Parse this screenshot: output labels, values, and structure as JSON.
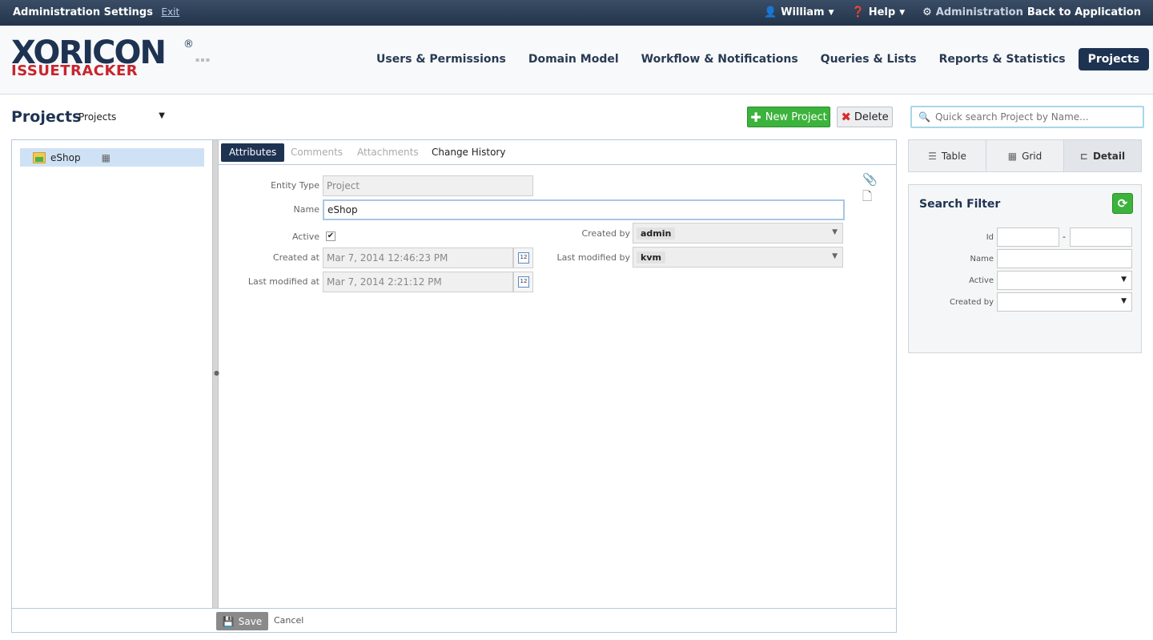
{
  "topbar": {
    "title": "Administration Settings",
    "exit": "Exit",
    "user": "William",
    "help": "Help",
    "admin": "Administration",
    "back": "Back to Application"
  },
  "logo": {
    "line1": "XORICON",
    "line2": "ISSUETRACKER",
    "reg": "®"
  },
  "nav": [
    {
      "label": "Users & Permissions"
    },
    {
      "label": "Domain Model"
    },
    {
      "label": "Workflow & Notifications"
    },
    {
      "label": "Queries & Lists"
    },
    {
      "label": "Reports & Statistics"
    },
    {
      "label": "Projects",
      "active": true
    }
  ],
  "page": {
    "title": "Projects",
    "selector": "Projects",
    "new_project": "New Project",
    "delete": "Delete",
    "search_placeholder": "Quick search Project by Name..."
  },
  "tree": {
    "item": "eShop"
  },
  "tabs": {
    "attributes": "Attributes",
    "comments": "Comments",
    "attachments": "Attachments",
    "history": "Change History"
  },
  "form": {
    "entity_type_label": "Entity Type",
    "entity_type_value": "Project",
    "name_label": "Name",
    "name_value": "eShop",
    "active_label": "Active",
    "active_check": "✔",
    "created_at_label": "Created at",
    "created_at_value": "Mar 7, 2014 12:46:23 PM",
    "last_modified_at_label": "Last modified at",
    "last_modified_at_value": "Mar 7, 2014 2:21:12 PM",
    "created_by_label": "Created by",
    "created_by_value": "admin",
    "last_modified_by_label": "Last modified by",
    "last_modified_by_value": "kvm",
    "calendar_day": "12"
  },
  "footer": {
    "save": "Save",
    "cancel": "Cancel"
  },
  "views": {
    "table": "Table",
    "grid": "Grid",
    "detail": "Detail"
  },
  "filter": {
    "title": "Search Filter",
    "id_label": "Id",
    "dash": "-",
    "name_label": "Name",
    "active_label": "Active",
    "created_by_label": "Created by"
  },
  "colors": {
    "navy": "#1e3352",
    "green": "#3cb33c",
    "red": "#c8252c"
  }
}
